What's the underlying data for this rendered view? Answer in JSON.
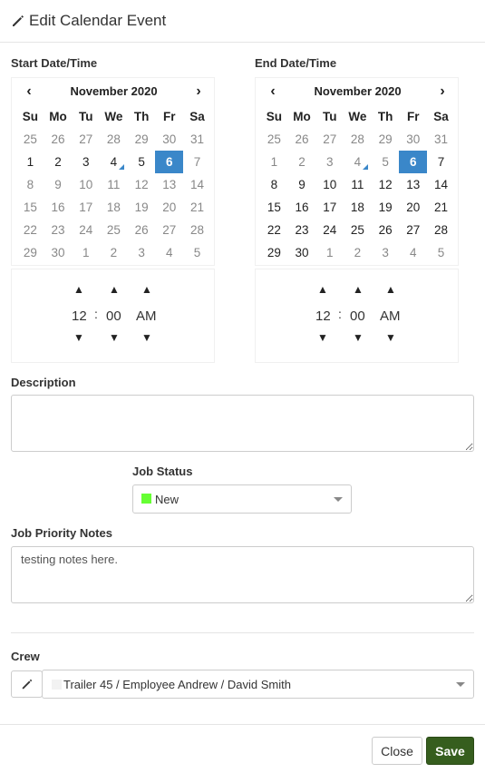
{
  "modal": {
    "title": "Edit Calendar Event",
    "title_icon": "pencil-icon"
  },
  "start": {
    "label": "Start Date/Time",
    "month": "November 2020",
    "prev": "‹",
    "next": "›",
    "dow": [
      "Su",
      "Mo",
      "Tu",
      "We",
      "Th",
      "Fr",
      "Sa"
    ],
    "weeks": [
      [
        "25",
        "26",
        "27",
        "28",
        "29",
        "30",
        "31"
      ],
      [
        "1",
        "2",
        "3",
        "4",
        "5",
        "6",
        "7"
      ],
      [
        "8",
        "9",
        "10",
        "11",
        "12",
        "13",
        "14"
      ],
      [
        "15",
        "16",
        "17",
        "18",
        "19",
        "20",
        "21"
      ],
      [
        "22",
        "23",
        "24",
        "25",
        "26",
        "27",
        "28"
      ],
      [
        "29",
        "30",
        "1",
        "2",
        "3",
        "4",
        "5"
      ]
    ],
    "time": {
      "hour": "12",
      "minute": "00",
      "period": "AM",
      "sep": ":"
    }
  },
  "end": {
    "label": "End Date/Time",
    "month": "November 2020",
    "prev": "‹",
    "next": "›",
    "dow": [
      "Su",
      "Mo",
      "Tu",
      "We",
      "Th",
      "Fr",
      "Sa"
    ],
    "weeks": [
      [
        "25",
        "26",
        "27",
        "28",
        "29",
        "30",
        "31"
      ],
      [
        "1",
        "2",
        "3",
        "4",
        "5",
        "6",
        "7"
      ],
      [
        "8",
        "9",
        "10",
        "11",
        "12",
        "13",
        "14"
      ],
      [
        "15",
        "16",
        "17",
        "18",
        "19",
        "20",
        "21"
      ],
      [
        "22",
        "23",
        "24",
        "25",
        "26",
        "27",
        "28"
      ],
      [
        "29",
        "30",
        "1",
        "2",
        "3",
        "4",
        "5"
      ]
    ],
    "time": {
      "hour": "12",
      "minute": "00",
      "period": "AM",
      "sep": ":"
    }
  },
  "description": {
    "label": "Description",
    "value": ""
  },
  "job_status": {
    "label": "Job Status",
    "value": "New",
    "color": "#66ff33"
  },
  "priority_notes": {
    "label": "Job Priority Notes",
    "value": "testing notes here."
  },
  "crew": {
    "label": "Crew",
    "value": "Trailer 45 / Employee Andrew / David Smith",
    "swatch_color": "#f2f2f2"
  },
  "footer": {
    "close_label": "Close",
    "save_label": "Save"
  },
  "colors": {
    "selected_day": "#3a87c9",
    "save_button": "#365e1e"
  }
}
